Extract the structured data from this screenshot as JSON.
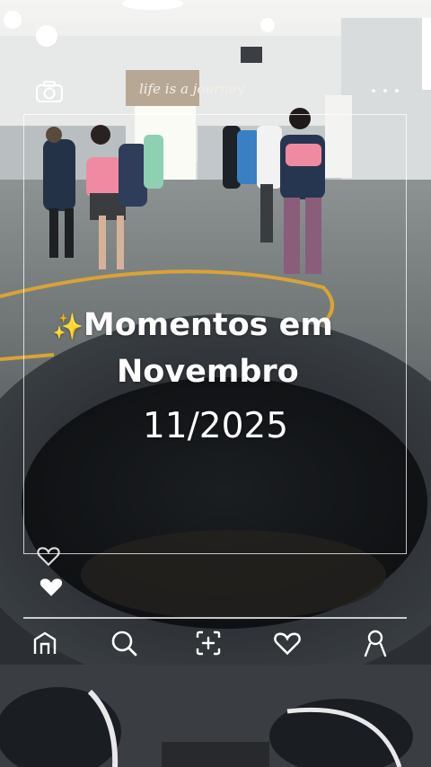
{
  "story": {
    "title_line1": "Momentos em",
    "title_line2": "Novembro",
    "date": "11/2025",
    "sparkle_emoji": "✨"
  },
  "background": {
    "wall_sign": "life is a journey"
  },
  "icons": {
    "camera": "camera-icon",
    "more": "more-dots-icon",
    "heart_outline": "heart-outline-icon",
    "heart_filled": "heart-filled-icon"
  },
  "nav": {
    "items": [
      {
        "icon": "home-icon"
      },
      {
        "icon": "search-icon"
      },
      {
        "icon": "add-post-icon"
      },
      {
        "icon": "heart-icon"
      },
      {
        "icon": "profile-icon"
      }
    ]
  },
  "colors": {
    "overlay_white": "#ffffff",
    "floor_line": "#d8a436"
  }
}
